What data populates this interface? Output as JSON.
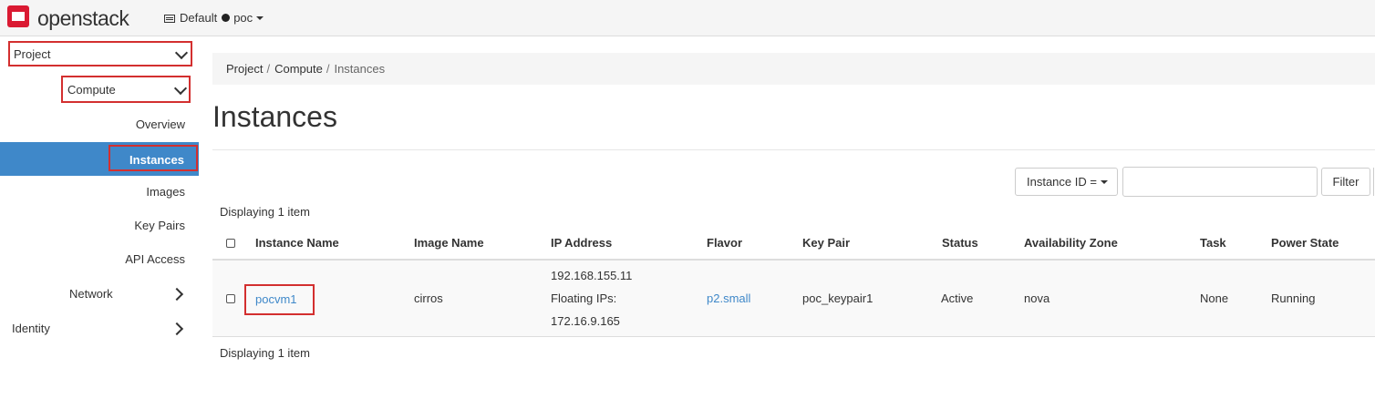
{
  "brand": {
    "name": "openstack",
    "logo_color": "#da1a32"
  },
  "context": {
    "domain": "Default",
    "project": "poc"
  },
  "sidebar": {
    "project_label": "Project",
    "compute_label": "Compute",
    "compute_items": [
      {
        "label": "Overview",
        "active": false
      },
      {
        "label": "Instances",
        "active": true
      },
      {
        "label": "Images",
        "active": false
      },
      {
        "label": "Key Pairs",
        "active": false
      },
      {
        "label": "API Access",
        "active": false
      }
    ],
    "network_label": "Network",
    "identity_label": "Identity",
    "active_color": "#3f88c9",
    "highlight_color": "#d32f2f"
  },
  "breadcrumb": [
    "Project",
    "Compute",
    "Instances"
  ],
  "page_title": "Instances",
  "filter": {
    "select_label": "Instance ID =",
    "input_value": "",
    "button_label": "Filter"
  },
  "display_count": "Displaying 1 item",
  "table": {
    "columns": [
      "Instance Name",
      "Image Name",
      "IP Address",
      "Flavor",
      "Key Pair",
      "Status",
      "Availability Zone",
      "Task",
      "Power State"
    ],
    "rows": [
      {
        "instance_name": "pocvm1",
        "image_name": "cirros",
        "ip_address": "192.168.155.11",
        "floating_label": "Floating IPs:",
        "floating_ip": "172.16.9.165",
        "flavor": "p2.small",
        "key_pair": "poc_keypair1",
        "status": "Active",
        "availability_zone": "nova",
        "task": "None",
        "power_state": "Running"
      }
    ]
  },
  "link_color": "#3f88c9"
}
